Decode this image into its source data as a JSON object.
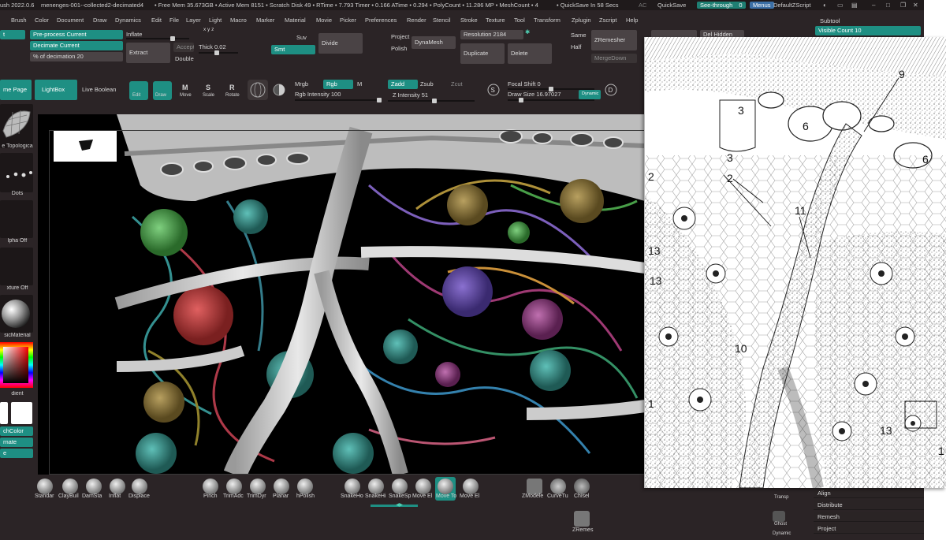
{
  "titlebar": {
    "app": "ush 2022.0.6",
    "file": "menenges-001--collected2-decimated4",
    "stats": "• Free Mem 35.673GB • Active Mem 8151 • Scratch Disk 49 • RTime • 7.793 Timer • 0.166 ATime • 0.294 • PolyCount • 11.286 MP • MeshCount • 4",
    "autosave": "• QuickSave In 58 Secs",
    "ac": "AC",
    "quicksave": "QuickSave",
    "see_through_label": "See-through",
    "see_through_value": "0",
    "menus": "Menus",
    "script": "DefaultZScript"
  },
  "menubar": [
    "Brush",
    "Color",
    "Document",
    "Draw",
    "Dynamics",
    "Edit",
    "File",
    "Layer",
    "Light",
    "Macro",
    "Marker",
    "Material",
    "Movie",
    "Picker",
    "Preferences",
    "Render",
    "Stencil",
    "Stroke",
    "Texture",
    "Tool",
    "Transform",
    "Zplugin",
    "Zscript",
    "Help"
  ],
  "toolbar1": {
    "left_stub": "t",
    "preprocess": "Pre-process Current",
    "decimate": "Decimate Current",
    "pct_decimation": "% of decimation",
    "pct_value": "20",
    "inflate": "Inflate",
    "xyz": "x y z",
    "extract": "Extract",
    "accept": "Accept",
    "thick_label": "Thick",
    "thick_value": "0.02",
    "double": "Double",
    "suv": "Suv",
    "smt": "Smt",
    "divide": "Divide",
    "project": "Project",
    "polish": "Polish",
    "dynamesh": "DynaMesh",
    "resolution_label": "Resolution",
    "resolution_value": "2184",
    "duplicate": "Duplicate",
    "delete": "Delete",
    "same": "Same",
    "half": "Half",
    "zremesher": "ZRemesher",
    "mergedown": "MergeDown",
    "del_hidden": "Del Hidden"
  },
  "subtool": {
    "title": "Subtool",
    "visible_count_label": "Visible Count",
    "visible_count_value": "10"
  },
  "toolbar2": {
    "home_page": "me Page",
    "lightbox": "LightBox",
    "live_boolean": "Live Boolean",
    "edit": "Edit",
    "draw": "Draw",
    "move": "Move",
    "scale": "Scale",
    "rotate": "Rotate",
    "mrgb": "Mrgb",
    "rgb": "Rgb",
    "m": "M",
    "rgb_intensity_label": "Rgb Intensity",
    "rgb_intensity_value": "100",
    "zadd": "Zadd",
    "zsub": "Zsub",
    "zcut": "Zcut",
    "z_intensity_label": "Z Intensity",
    "z_intensity_value": "51",
    "focal_shift_label": "Focal Shift",
    "focal_shift_value": "0",
    "draw_size_label": "Draw Size",
    "draw_size_value": "16.97027",
    "dynamic": "Dynamic"
  },
  "leftpanel": {
    "topological": "e Topologica",
    "dots": "Dots",
    "alpha_off": "lpha Off",
    "texture_off": "xture Off",
    "material": "sicMaterial",
    "gradient": "dient",
    "switch_color": "chColor",
    "alternate": "rnate",
    "last": "e"
  },
  "brushes": [
    "Standar",
    "ClayBuil",
    "DamSta",
    "Inflat",
    "Displace",
    "Pinch",
    "TrimAdc",
    "TrimDyr",
    "Planar",
    "hPolish",
    "SnakeHo",
    "SnakeHi",
    "SnakeSp",
    "Move El",
    "Move To",
    "Move El",
    "ZModele",
    "CurveTu",
    "Chisel"
  ],
  "zremesher_tray": "ZRemes",
  "right_sidebar": {
    "transp": "Transp",
    "ghost": "Ghost",
    "dynamic": "Dynamic"
  },
  "subtool_menu": [
    "Align",
    "Distribute",
    "Remesh",
    "Project"
  ],
  "illustration_labels": [
    "9",
    "3",
    "6",
    "3",
    "6",
    "2",
    "2",
    "11",
    "13",
    "13",
    "10",
    "13",
    "1",
    "1"
  ],
  "colors": {
    "accent": "#1e8f83",
    "background": "#2b2426",
    "panel": "#4a4345"
  }
}
